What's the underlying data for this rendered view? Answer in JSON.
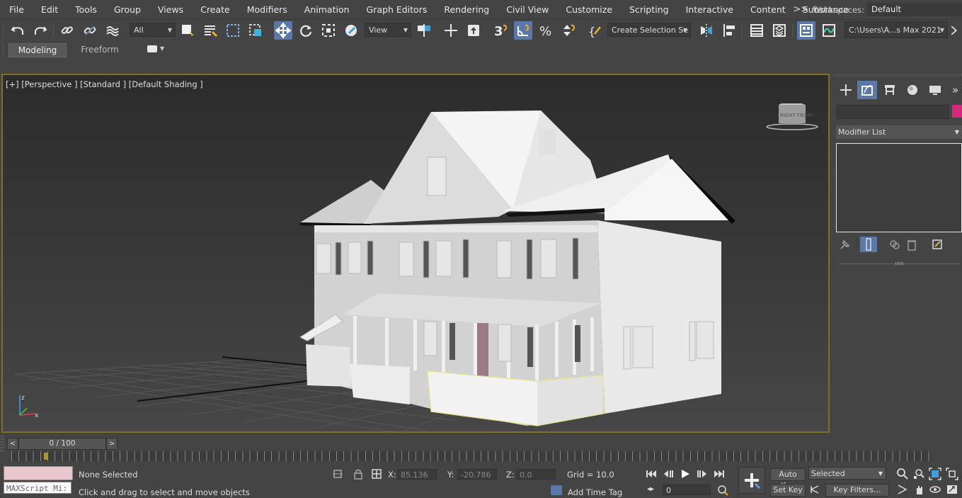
{
  "menu": {
    "items": [
      "File",
      "Edit",
      "Tools",
      "Group",
      "Views",
      "Create",
      "Modifiers",
      "Animation",
      "Graph Editors",
      "Rendering",
      "Civil View",
      "Customize",
      "Scripting",
      "Interactive",
      "Content",
      "Substance"
    ],
    "more": ">>",
    "workspaces_label": "Workspaces:",
    "workspaces_value": "Default"
  },
  "toolbar": {
    "filter_dropdown": "All",
    "ref_coord_dropdown": "View",
    "selection_set": "Create Selection Se",
    "project_path": "C:\\Users\\A...s Max 2021"
  },
  "ribbon": {
    "tabs": [
      "Modeling",
      "Freeform"
    ]
  },
  "viewport": {
    "label": "[+] [Perspective ] [Standard ] [Default Shading ]",
    "viewcube_text": "RIGHT FRONT",
    "axis_z": "z",
    "axis_x": "x"
  },
  "command_panel": {
    "modifier_list": "Modifier List",
    "more": "»",
    "color_swatch": "#d6287c"
  },
  "timeline": {
    "frame_display": "0 / 100",
    "prev": "<",
    "next": ">"
  },
  "status": {
    "maxscript": "MAXScript Mi:",
    "selection": "None Selected",
    "prompt": "Click and drag to select and move objects",
    "x_label": "X:",
    "x_value": "85.136",
    "y_label": "Y:",
    "y_value": "-20.786",
    "z_label": "Z:",
    "z_value": "0.0",
    "grid": "Grid = 10.0",
    "add_time_tag": "Add Time Tag",
    "auto_key": "Auto Key",
    "selected_dropdown": "Selected",
    "set_key": "Set Key",
    "key_filters": "Key Filters...",
    "frame_value": "0"
  },
  "colors": {
    "accent": "#5b79a8",
    "viewport_border": "#7d7126",
    "selection_box": "#e6e68a"
  }
}
